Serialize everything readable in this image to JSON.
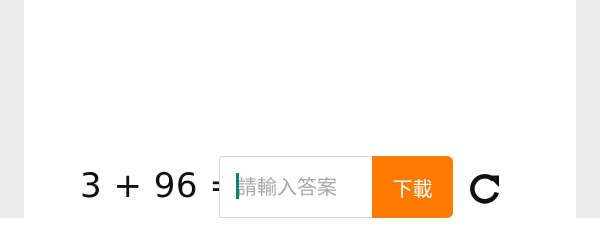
{
  "captcha": {
    "equation": "3 + 96 =",
    "answer_value": "",
    "answer_placeholder": "請輸入答案",
    "submit_label": "下載",
    "refresh_icon": "refresh-icon"
  },
  "colors": {
    "accent": "#ff7a00",
    "caret": "#10806f",
    "gutter": "#ebebeb"
  }
}
